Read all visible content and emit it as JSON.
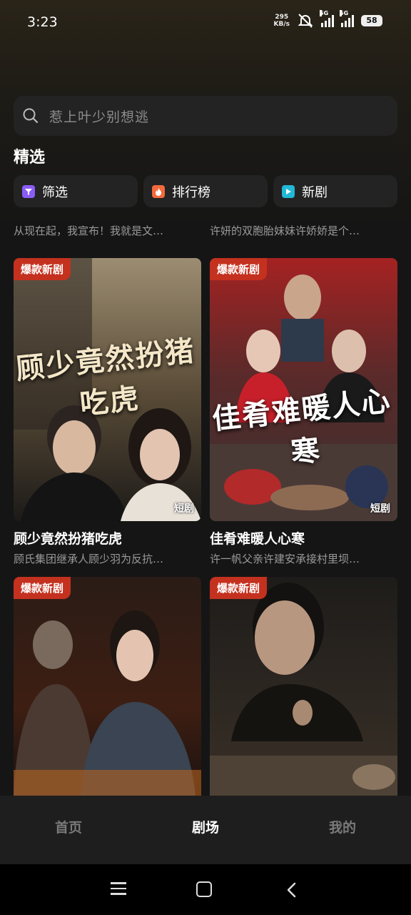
{
  "status_bar": {
    "time": "3:23",
    "net_speed_value": "295",
    "net_speed_unit": "KB/s",
    "signal_1": "5G",
    "signal_2": "5G",
    "battery": "58"
  },
  "search": {
    "placeholder": "惹上叶少别想逃"
  },
  "section": {
    "title": "精选"
  },
  "chips": [
    {
      "label": "筛选",
      "icon": "filter-icon",
      "color": "#8a5cf6"
    },
    {
      "label": "排行榜",
      "icon": "flame-icon",
      "color": "#f26a3c"
    },
    {
      "label": "新剧",
      "icon": "play-icon",
      "color": "#22b8d6"
    }
  ],
  "partial_row": [
    {
      "desc": "从现在起，我宣布！我就是文…"
    },
    {
      "desc": "许妍的双胞胎妹妹许娇娇是个…"
    }
  ],
  "cards": [
    {
      "badge": "爆款新剧",
      "poster_text": "顾少竟然扮猪吃虎",
      "tag": "短剧",
      "title": "顾少竟然扮猪吃虎",
      "desc": "顾氏集团继承人顾少羽为反抗…",
      "tone": "#6b5a3e"
    },
    {
      "badge": "爆款新剧",
      "poster_text": "佳肴难暖人心寒",
      "tag": "短剧",
      "title": "佳肴难暖人心寒",
      "desc": "许一帆父亲许建安承接村里坝…",
      "tone": "#8a1c1c"
    },
    {
      "badge": "爆款新剧",
      "poster_text": "",
      "tag": "",
      "title": "",
      "desc": "",
      "tone": "#3a1c12"
    },
    {
      "badge": "爆款新剧",
      "poster_text": "",
      "tag": "",
      "title": "",
      "desc": "",
      "tone": "#2b2620"
    }
  ],
  "tabs": [
    {
      "label": "首页",
      "active": false
    },
    {
      "label": "剧场",
      "active": true
    },
    {
      "label": "我的",
      "active": false
    }
  ]
}
